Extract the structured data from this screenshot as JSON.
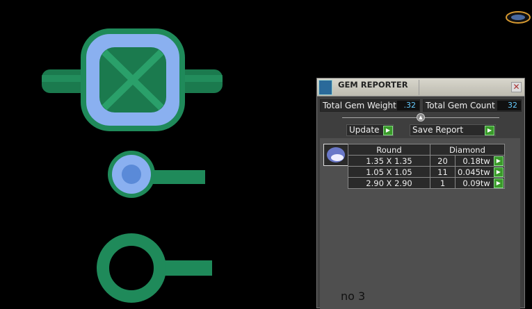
{
  "panel": {
    "title": "GEM REPORTER",
    "close_icon": "close-icon",
    "total_weight_label": "Total Gem Weight",
    "total_weight": ".32",
    "total_count_label": "Total Gem Count",
    "total_count": "32",
    "update_label": "Update",
    "save_report_label": "Save Report",
    "table": {
      "headers": [
        "Round",
        "Diamond"
      ],
      "rows": [
        {
          "size": "1.35 X 1.35",
          "count": "20",
          "weight": "0.18tw"
        },
        {
          "size": "1.05 X 1.05",
          "count": "11",
          "weight": "0.045tw"
        },
        {
          "size": "2.90 X 2.90",
          "count": "1",
          "weight": "0.09tw"
        }
      ]
    },
    "note": "no 3"
  },
  "colors": {
    "metal": "#1f8a5a",
    "gem": "#8ab0f0",
    "accent": "#3a9a2a"
  }
}
